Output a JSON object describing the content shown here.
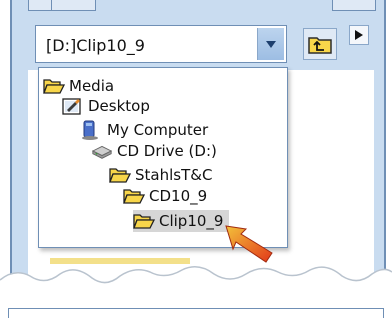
{
  "combo": {
    "value": "[D:]Clip10_9"
  },
  "dropdown": {
    "items": [
      {
        "label": "Media",
        "icon": "open-folder-icon",
        "level": 0
      },
      {
        "label": "Desktop",
        "icon": "desktop-icon",
        "level": 1
      },
      {
        "label": "My Computer",
        "icon": "my-computer-icon",
        "level": 2
      },
      {
        "label": "CD Drive (D:)",
        "icon": "cd-drive-icon",
        "level": 3
      },
      {
        "label": "StahlsT&C",
        "icon": "open-folder-icon",
        "level": 4
      },
      {
        "label": "CD10_9",
        "icon": "open-folder-icon",
        "level": 5
      },
      {
        "label": "Clip10_9",
        "icon": "open-folder-icon",
        "level": 6,
        "selected": true
      }
    ]
  },
  "colors": {
    "panel_bg": "#c9dcf0",
    "folder_yellow": "#f8d64a",
    "pointer_arrow": "#e2381a"
  }
}
